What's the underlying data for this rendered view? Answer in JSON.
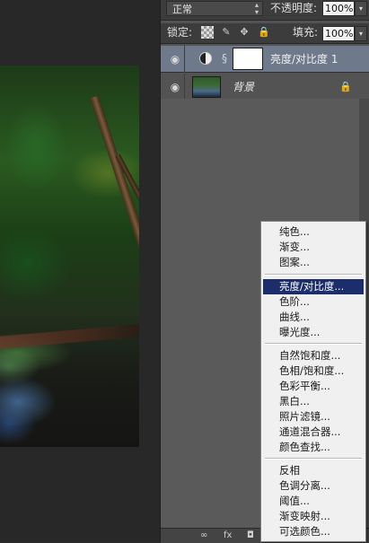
{
  "toolbar": {
    "blend_mode": "正常",
    "opacity_label": "不透明度:",
    "opacity_value": "100%",
    "lock_label": "锁定:",
    "fill_label": "填充:",
    "fill_value": "100%"
  },
  "layers": [
    {
      "name": "亮度/对比度 1",
      "type": "adjustment",
      "selected": true,
      "visible": true
    },
    {
      "name": "背景",
      "type": "background",
      "selected": false,
      "visible": true,
      "locked": true
    }
  ],
  "context_menu": {
    "groups": [
      [
        "纯色...",
        "渐变...",
        "图案..."
      ],
      [
        "亮度/对比度...",
        "色阶...",
        "曲线...",
        "曝光度..."
      ],
      [
        "自然饱和度...",
        "色相/饱和度...",
        "色彩平衡...",
        "黑白...",
        "照片滤镜...",
        "通道混合器...",
        "颜色查找..."
      ],
      [
        "反相",
        "色调分离...",
        "阈值...",
        "渐变映射...",
        "可选颜色..."
      ]
    ],
    "highlighted": "亮度/对比度..."
  },
  "colors": {
    "panel_bg": "#535353",
    "selected_layer": "#6e7a8c",
    "menu_bg": "#f0f0f0",
    "menu_highlight": "#1b2d6b"
  }
}
